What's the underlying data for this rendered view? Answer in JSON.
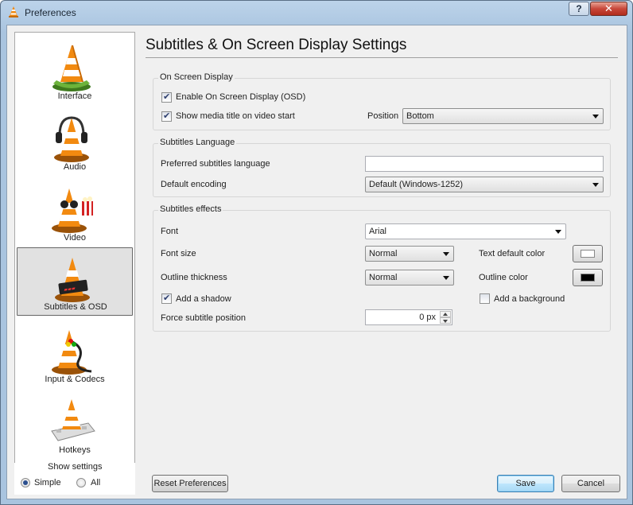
{
  "window": {
    "title": "Preferences",
    "help_label": "?",
    "close_label": "✕"
  },
  "sidebar": {
    "items": [
      {
        "label": "Interface",
        "icon": "cone-interface-icon"
      },
      {
        "label": "Audio",
        "icon": "cone-headphones-icon"
      },
      {
        "label": "Video",
        "icon": "cone-glasses-popcorn-icon"
      },
      {
        "label": "Subtitles & OSD",
        "icon": "cone-subtitles-icon",
        "selected": true
      },
      {
        "label": "Input & Codecs",
        "icon": "cone-cable-icon"
      },
      {
        "label": "Hotkeys",
        "icon": "cone-keyboard-icon"
      }
    ],
    "show_settings": {
      "legend": "Show settings",
      "simple": "Simple",
      "all": "All",
      "selected": "Simple"
    }
  },
  "page": {
    "title": "Subtitles & On Screen Display Settings"
  },
  "osd": {
    "group_title": "On Screen Display",
    "enable_osd": {
      "label": "Enable On Screen Display (OSD)",
      "checked": true
    },
    "show_title": {
      "label": "Show media title on video start",
      "checked": true
    },
    "position_label": "Position",
    "position_value": "Bottom"
  },
  "language": {
    "group_title": "Subtitles Language",
    "preferred_label": "Preferred subtitles language",
    "preferred_value": "",
    "encoding_label": "Default encoding",
    "encoding_value": "Default (Windows-1252)"
  },
  "effects": {
    "group_title": "Subtitles effects",
    "font_label": "Font",
    "font_value": "Arial",
    "font_size_label": "Font size",
    "font_size_value": "Normal",
    "text_color_label": "Text default color",
    "text_color": "#ffffff",
    "outline_thickness_label": "Outline thickness",
    "outline_thickness_value": "Normal",
    "outline_color_label": "Outline color",
    "outline_color": "#000000",
    "shadow": {
      "label": "Add a shadow",
      "checked": true
    },
    "background": {
      "label": "Add a background",
      "checked": false
    },
    "force_position_label": "Force subtitle position",
    "force_position_value": "0 px"
  },
  "buttons": {
    "reset": "Reset Preferences",
    "save": "Save",
    "cancel": "Cancel"
  }
}
